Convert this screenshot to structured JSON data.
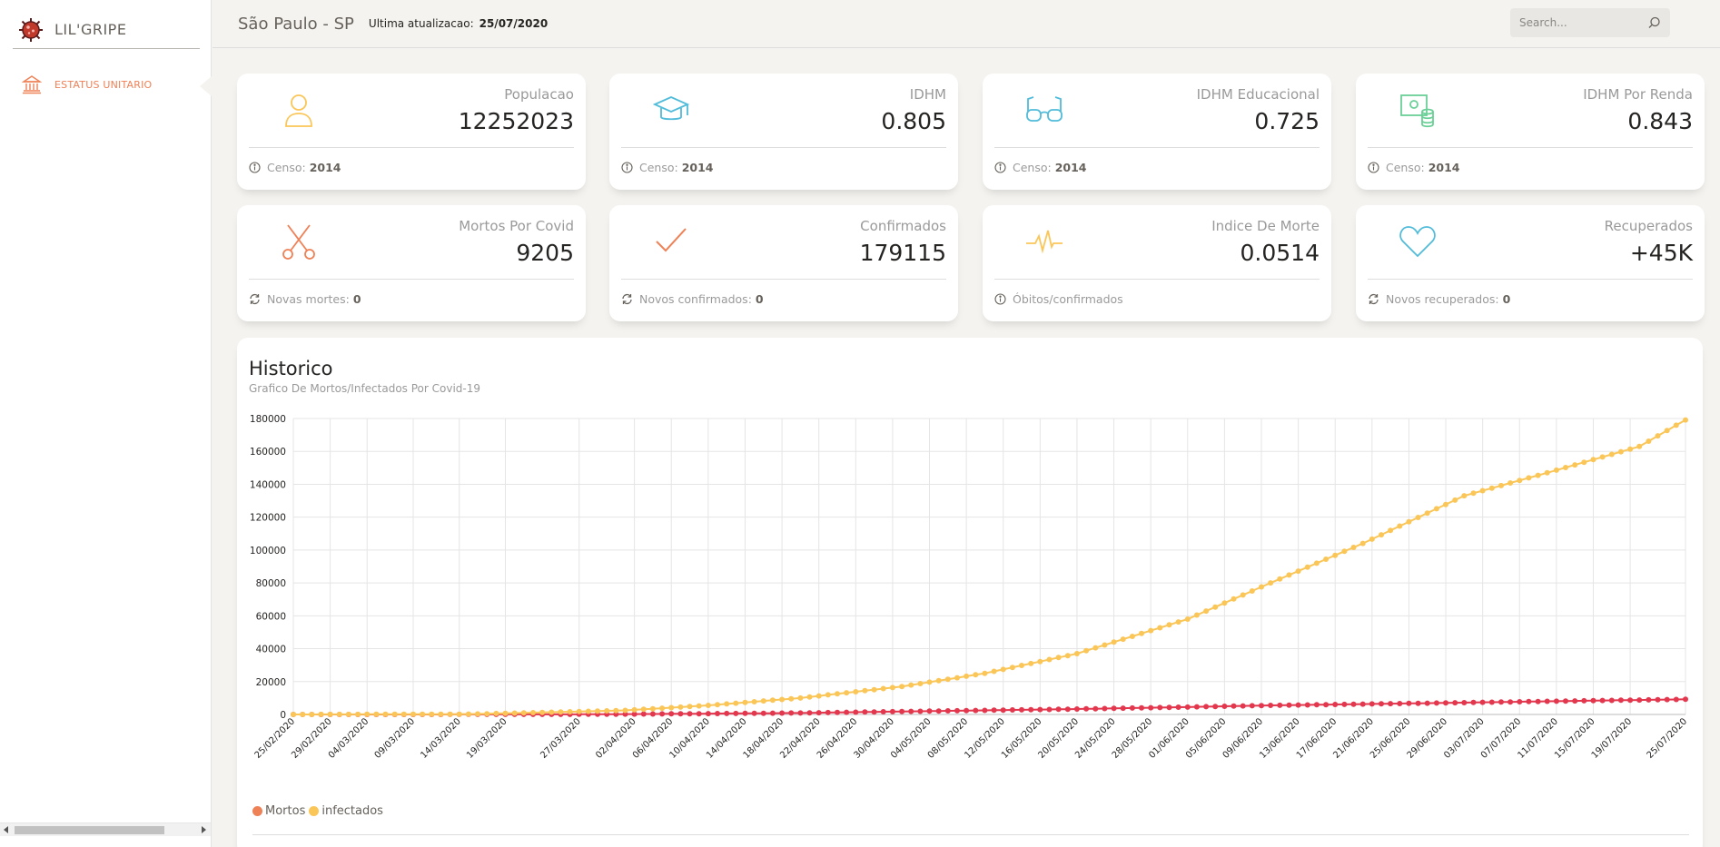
{
  "app": {
    "title": "LIL'GRIPE"
  },
  "sidebar": {
    "items": [
      {
        "label": "ESTATUS UNITARIO",
        "icon": "bank-icon"
      }
    ]
  },
  "header": {
    "location": "São Paulo - SP",
    "update_label": "Ultima atualizacao:",
    "update_date": "25/07/2020",
    "search_placeholder": "Search..."
  },
  "colors": {
    "accent": "#ef8157",
    "deaths": "#e3374e",
    "infected": "#fbc658",
    "info": "#51bcda",
    "success": "#6bd098"
  },
  "stats": [
    {
      "label": "Populacao",
      "value": "12252023",
      "footer_text": "Censo:",
      "footer_value": "2014",
      "icon": "person-icon"
    },
    {
      "label": "IDHM",
      "value": "0.805",
      "footer_text": "Censo:",
      "footer_value": "2014",
      "icon": "graduation-cap-icon"
    },
    {
      "label": "IDHM Educacional",
      "value": "0.725",
      "footer_text": "Censo:",
      "footer_value": "2014",
      "icon": "glasses-icon"
    },
    {
      "label": "IDHM Por Renda",
      "value": "0.843",
      "footer_text": "Censo:",
      "footer_value": "2014",
      "icon": "money-coins-icon"
    },
    {
      "label": "Mortos Por Covid",
      "value": "9205",
      "footer_text": "Novas mortes:",
      "footer_value": "0",
      "icon": "scissors-icon"
    },
    {
      "label": "Confirmados",
      "value": "179115",
      "footer_text": "Novos confirmados:",
      "footer_value": "0",
      "icon": "check-icon"
    },
    {
      "label": "Indice De Morte",
      "value": "0.0514",
      "footer_text": "Óbitos/confirmados",
      "footer_value": "",
      "icon": "pulse-icon"
    },
    {
      "label": "Recuperados",
      "value": "+45K",
      "footer_text": "Novos recuperados:",
      "footer_value": "0",
      "icon": "heart-icon"
    }
  ],
  "chart": {
    "title": "Historico",
    "subtitle": "Grafico De Mortos/Infectados Por Covid-19"
  },
  "chart_data": {
    "type": "line",
    "x_start": "25/02/2020",
    "x_end": "25/07/2020",
    "x_tick_labels": [
      "25/02/2020",
      "29/02/2020",
      "04/03/2020",
      "09/03/2020",
      "14/03/2020",
      "19/03/2020",
      "27/03/2020",
      "02/04/2020",
      "06/04/2020",
      "10/04/2020",
      "14/04/2020",
      "18/04/2020",
      "22/04/2020",
      "26/04/2020",
      "30/04/2020",
      "04/05/2020",
      "08/05/2020",
      "12/05/2020",
      "16/05/2020",
      "20/05/2020",
      "24/05/2020",
      "28/05/2020",
      "01/06/2020",
      "05/06/2020",
      "09/06/2020",
      "13/06/2020",
      "17/06/2020",
      "21/06/2020",
      "25/06/2020",
      "29/06/2020",
      "03/07/2020",
      "07/07/2020",
      "11/07/2020",
      "15/07/2020",
      "19/07/2020",
      "25/07/2020"
    ],
    "y_ticks": [
      0,
      20000,
      40000,
      60000,
      80000,
      100000,
      120000,
      140000,
      160000,
      180000
    ],
    "ylim": [
      0,
      180000
    ],
    "grid": true,
    "legend_position": "bottom-left",
    "series": [
      {
        "name": "Mortos",
        "color": "#e3374e",
        "points": [
          [
            "25/02/2020",
            0
          ],
          [
            "25/03/2020",
            50
          ],
          [
            "01/04/2020",
            200
          ],
          [
            "10/04/2020",
            500
          ],
          [
            "20/04/2020",
            900
          ],
          [
            "01/05/2020",
            1800
          ],
          [
            "10/05/2020",
            2500
          ],
          [
            "20/05/2020",
            3300
          ],
          [
            "01/06/2020",
            4500
          ],
          [
            "10/06/2020",
            5500
          ],
          [
            "20/06/2020",
            6300
          ],
          [
            "01/07/2020",
            7200
          ],
          [
            "10/07/2020",
            8000
          ],
          [
            "25/07/2020",
            9205
          ]
        ]
      },
      {
        "name": "infectados",
        "color": "#fbc658",
        "points": [
          [
            "25/02/2020",
            0
          ],
          [
            "15/03/2020",
            200
          ],
          [
            "25/03/2020",
            1500
          ],
          [
            "01/04/2020",
            2500
          ],
          [
            "10/04/2020",
            5500
          ],
          [
            "20/04/2020",
            10000
          ],
          [
            "01/05/2020",
            17000
          ],
          [
            "10/05/2020",
            25000
          ],
          [
            "20/05/2020",
            37000
          ],
          [
            "01/06/2020",
            58000
          ],
          [
            "10/06/2020",
            80000
          ],
          [
            "20/06/2020",
            104000
          ],
          [
            "01/07/2020",
            133000
          ],
          [
            "10/07/2020",
            147000
          ],
          [
            "20/07/2020",
            163000
          ],
          [
            "25/07/2020",
            179115
          ]
        ]
      }
    ]
  }
}
